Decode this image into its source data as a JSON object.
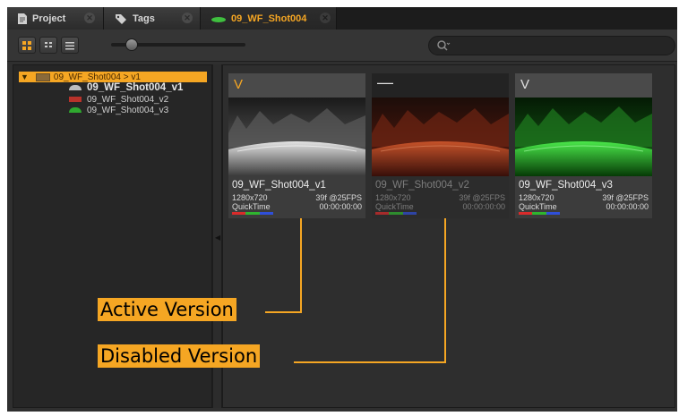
{
  "tabs": [
    {
      "label": "Project",
      "icon": "page-icon",
      "close": "✕"
    },
    {
      "label": "Tags",
      "icon": "tags-icon",
      "close": "✕"
    },
    {
      "label": "09_WF_Shot004",
      "icon": "green-swatch-icon",
      "close": "✕"
    }
  ],
  "toolbar": {
    "view_buttons": [
      "grid-view-icon",
      "thumbnail-view-icon",
      "list-view-icon"
    ],
    "thumbnail_size": 0.12,
    "search": {
      "placeholder": "",
      "value": ""
    }
  },
  "tree": {
    "root": {
      "label": "09_WF_Shot004 > v1",
      "expanded": true
    },
    "items": [
      {
        "label": "09_WF_Shot004_v1",
        "swatch": "#bdbdbd",
        "active": true
      },
      {
        "label": "09_WF_Shot004_v2",
        "swatch": "#b8322a",
        "active": false
      },
      {
        "label": "09_WF_Shot004_v3",
        "swatch": "#2fa82f",
        "active": false
      }
    ]
  },
  "versions": [
    {
      "flag": "V",
      "name": "09_WF_Shot004_v1",
      "resolution": "1280x720",
      "frames": "39f @25FPS",
      "format": "QuickTime",
      "timecode": "00:00:00:00",
      "tint": "grey"
    },
    {
      "flag": "—",
      "name": "09_WF_Shot004_v2",
      "resolution": "1280x720",
      "frames": "39f @25FPS",
      "format": "QuickTime",
      "timecode": "00:00:00:00",
      "tint": "red"
    },
    {
      "flag": "V",
      "name": "09_WF_Shot004_v3",
      "resolution": "1280x720",
      "frames": "39f @25FPS",
      "format": "QuickTime",
      "timecode": "00:00:00:00",
      "tint": "green"
    }
  ],
  "callouts": {
    "active": "Active Version",
    "disabled": "Disabled Version"
  },
  "colors": {
    "accent": "#f5a623",
    "panel": "#2e2e2e",
    "channel_bar": [
      "#d92b2b",
      "#2fb52f",
      "#2f4fd9"
    ]
  }
}
